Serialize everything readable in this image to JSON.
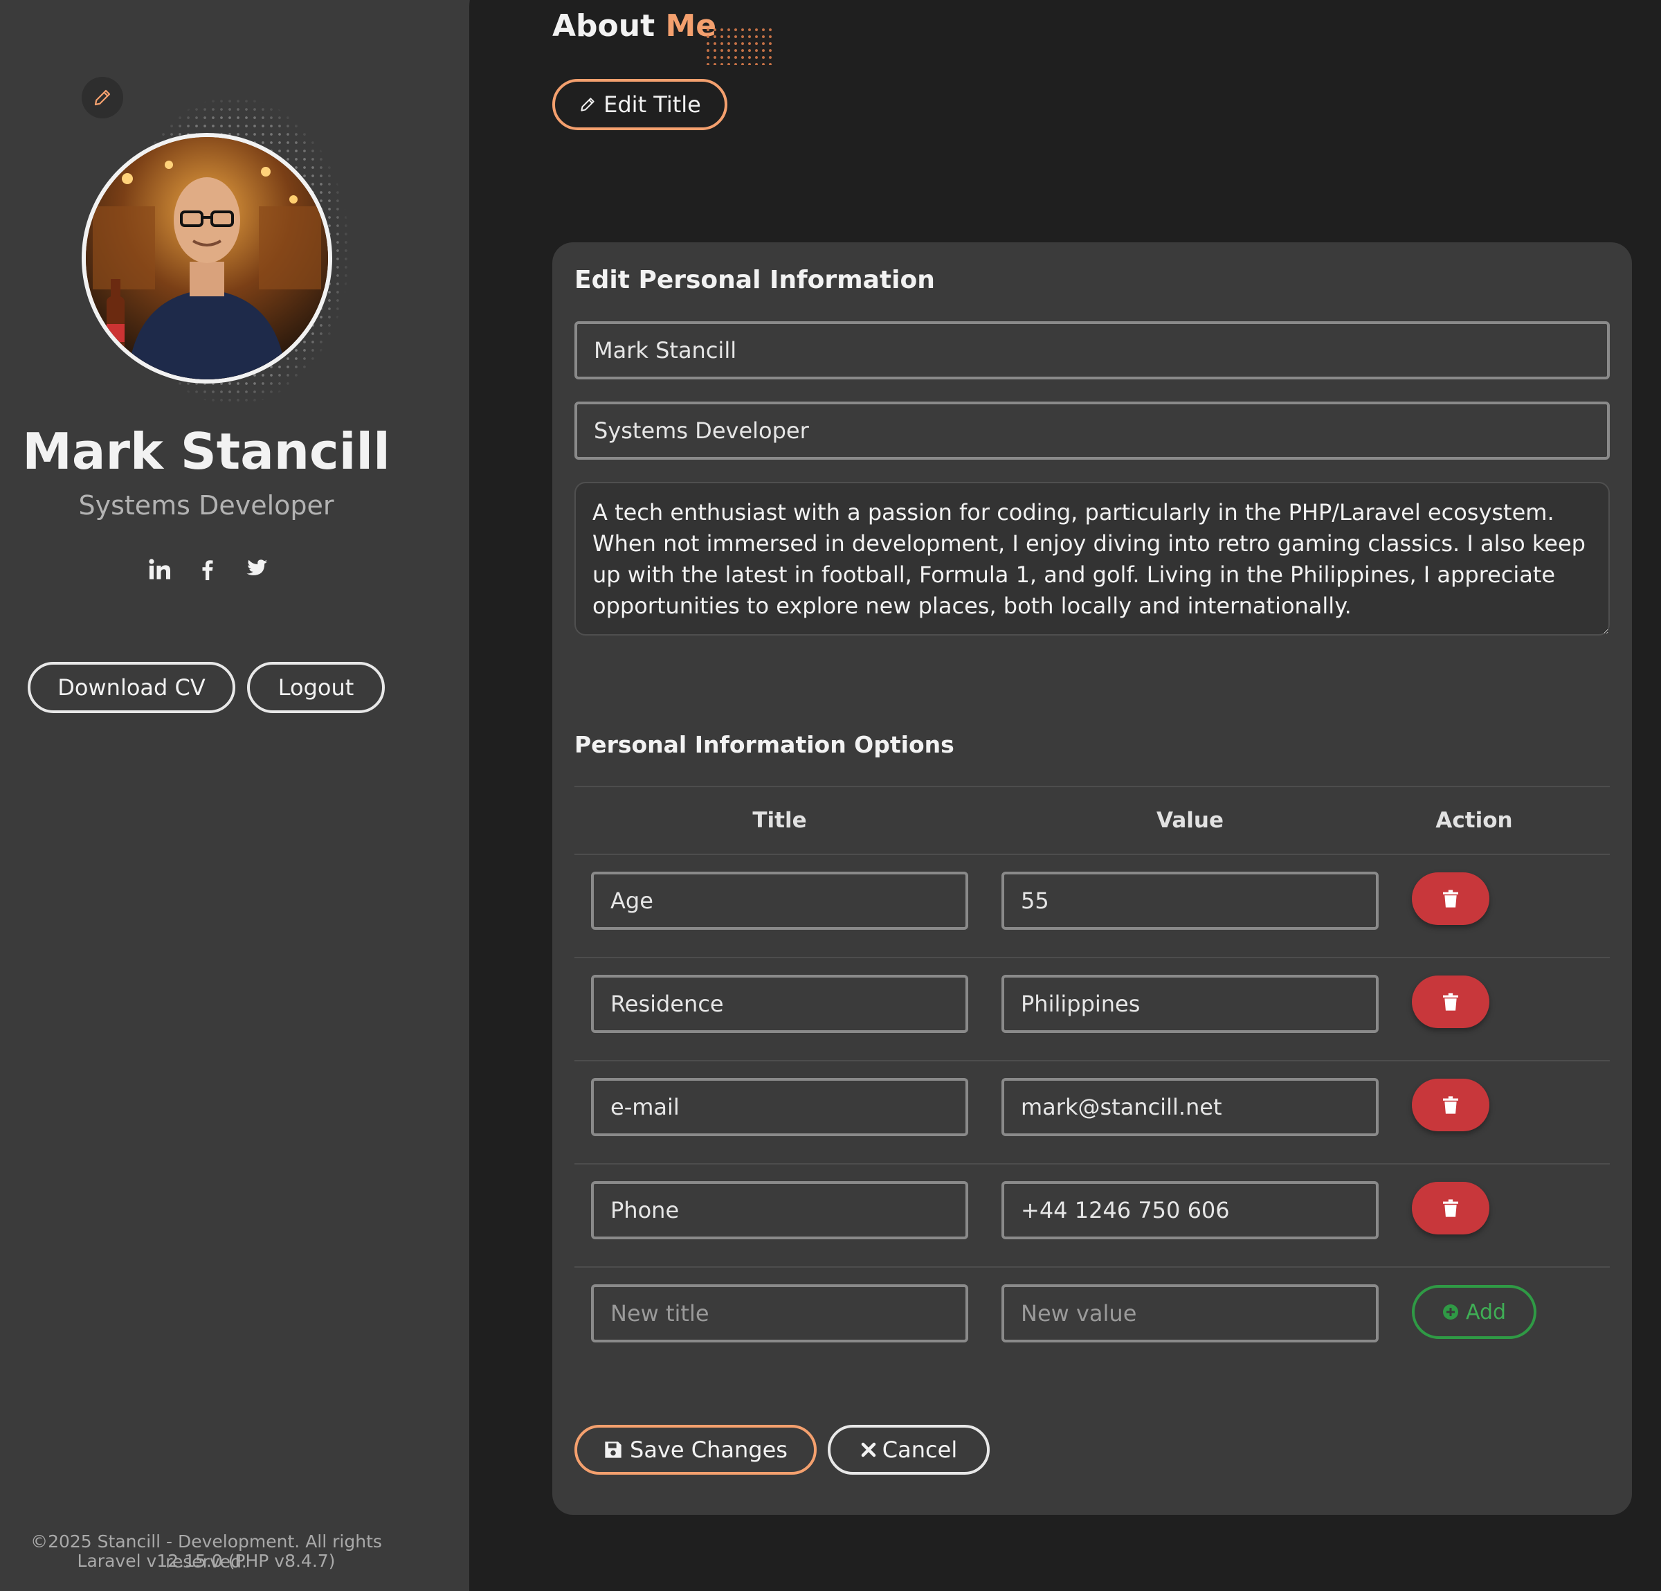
{
  "sidebar": {
    "name": "Mark Stancill",
    "job_title": "Systems Developer",
    "socials": [
      {
        "label": "in",
        "icon": "linkedin-icon"
      },
      {
        "label": "f",
        "icon": "facebook-icon"
      },
      {
        "label": "",
        "icon": "twitter-icon"
      }
    ],
    "download_cv_label": "Download CV",
    "logout_label": "Logout",
    "footer_copyright": "©2025 Stancill - Development. All rights reserved.",
    "footer_version": "Laravel v12.15.0 (PHP v8.4.7)"
  },
  "header": {
    "title_part1": "About",
    "title_part2": "Me",
    "edit_title_label": "Edit Title"
  },
  "form": {
    "heading": "Edit Personal Information",
    "name_value": "Mark Stancill",
    "job_title_value": "Systems Developer",
    "bio_value": "A tech enthusiast with a passion for coding, particularly in the PHP/Laravel ecosystem. When not immersed in development, I enjoy diving into retro gaming classics. I also keep up with the latest in football, Formula 1, and golf. Living in the Philippines, I appreciate opportunities to explore new places, both locally and internationally."
  },
  "options": {
    "heading": "Personal Information Options",
    "columns": [
      "Title",
      "Value",
      "Action"
    ],
    "rows": [
      {
        "title": "Age",
        "value": "55"
      },
      {
        "title": "Residence",
        "value": "Philippines"
      },
      {
        "title": "e-mail",
        "value": "mark@stancill.net"
      },
      {
        "title": "Phone",
        "value": "+44 1246 750 606"
      }
    ],
    "new_title_placeholder": "New title",
    "new_value_placeholder": "New value",
    "add_label": "Add"
  },
  "actions": {
    "save_label": "Save Changes",
    "cancel_label": "Cancel"
  },
  "colors": {
    "accent": "#f4a06e",
    "danger": "#c8373b",
    "success": "#2f9a45",
    "sidebar_bg": "#3b3b3b",
    "main_bg": "#1f1f1f"
  }
}
